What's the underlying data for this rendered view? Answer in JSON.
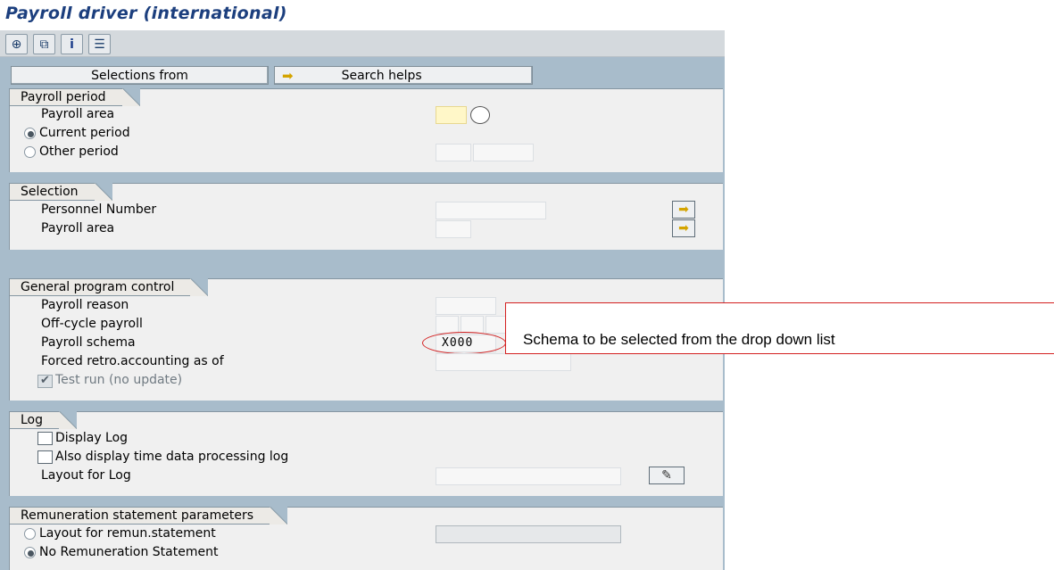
{
  "title": "Payroll driver (international)",
  "toolbar": {
    "icons": [
      "execute-icon",
      "copy-variant-icon",
      "info-icon",
      "selection-options-icon"
    ]
  },
  "buttons": {
    "selections_from": "Selections from",
    "search_helps": "Search helps"
  },
  "payroll_period": {
    "header": "Payroll period",
    "payroll_area_label": "Payroll area",
    "current_period_label": "Current period",
    "other_period_label": "Other period",
    "current_period_selected": true
  },
  "selection": {
    "header": "Selection",
    "personnel_number_label": "Personnel Number",
    "payroll_area_label": "Payroll area"
  },
  "general_program_control": {
    "header": "General program control",
    "payroll_reason_label": "Payroll reason",
    "off_cycle_label": "Off-cycle payroll",
    "payroll_schema_label": "Payroll schema",
    "payroll_schema_value": "X000",
    "forced_retro_label": "Forced retro.accounting as of",
    "test_run_label": "Test run (no update)",
    "test_run_checked": true
  },
  "log": {
    "header": "Log",
    "display_log_label": "Display Log",
    "time_data_log_label": "Also display time data processing log",
    "layout_label": "Layout for Log"
  },
  "remuneration": {
    "header": "Remuneration statement parameters",
    "layout_label": "Layout for remun.statement",
    "no_statement_label": "No Remuneration Statement",
    "no_statement_selected": true
  },
  "annotation": {
    "text": "Schema to be selected from the drop down list",
    "highlight_color": "#d42020"
  },
  "colors": {
    "title": "#1c3f7e",
    "background": "#a8bccb",
    "panel": "#f0f0f0",
    "arrow": "#d4a400"
  }
}
